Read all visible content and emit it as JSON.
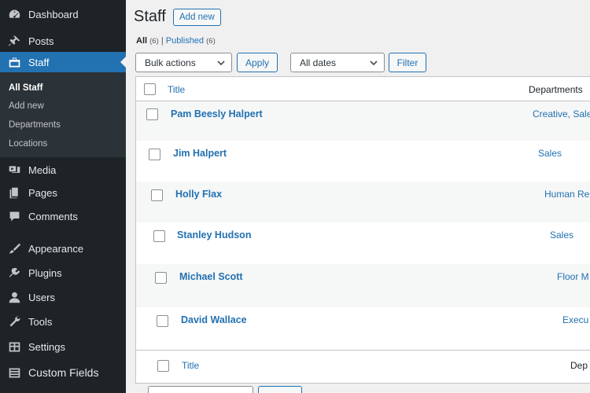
{
  "sidebar": {
    "items": [
      {
        "label": "Dashboard",
        "icon": "dashboard-icon"
      },
      {
        "label": "Posts",
        "icon": "pin-icon"
      },
      {
        "label": "Staff",
        "icon": "staff-icon"
      },
      {
        "label": "Media",
        "icon": "media-icon"
      },
      {
        "label": "Pages",
        "icon": "pages-icon"
      },
      {
        "label": "Comments",
        "icon": "comment-icon"
      },
      {
        "label": "Appearance",
        "icon": "paintbrush-icon"
      },
      {
        "label": "Plugins",
        "icon": "plugin-icon"
      },
      {
        "label": "Users",
        "icon": "user-icon"
      },
      {
        "label": "Tools",
        "icon": "wrench-icon"
      },
      {
        "label": "Settings",
        "icon": "settings-icon"
      },
      {
        "label": "Custom Fields",
        "icon": "custom-fields-icon"
      }
    ],
    "submenu": [
      "All Staff",
      "Add new",
      "Departments",
      "Locations"
    ]
  },
  "main": {
    "title": "Staff",
    "add_new": "Add new",
    "filters": {
      "all_label": "All",
      "all_count": "(6)",
      "separator": "|",
      "published_label": "Published",
      "published_count": "(6)"
    },
    "bulk_actions": "Bulk actions",
    "apply": "Apply",
    "all_dates": "All dates",
    "filter": "Filter"
  },
  "table": {
    "columns": {
      "title": "Title",
      "departments": "Departments",
      "footer_departments": "Dep"
    },
    "rows": [
      {
        "title": "Pam Beesly Halpert",
        "department": "Creative, Sale"
      },
      {
        "title": "Jim Halpert",
        "department": "Sales"
      },
      {
        "title": "Holly Flax",
        "department": "Human Re"
      },
      {
        "title": "Stanley Hudson",
        "department": "Sales"
      },
      {
        "title": "Michael Scott",
        "department": "Floor M"
      },
      {
        "title": "David Wallace",
        "department": "Execu"
      }
    ]
  },
  "colors": {
    "accent": "#2271b1",
    "sidebar": "#1d2327",
    "submenu": "#2c3338"
  }
}
